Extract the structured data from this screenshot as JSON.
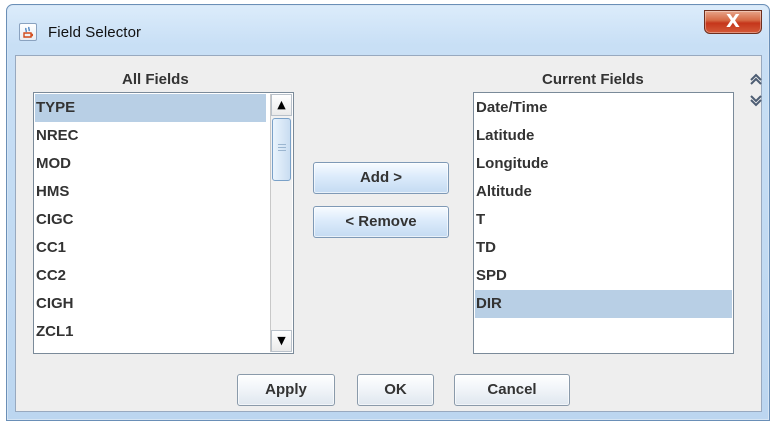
{
  "window": {
    "title": "Field Selector",
    "close_label": "X"
  },
  "all_fields": {
    "label": "All Fields",
    "items": [
      "TYPE",
      "NREC",
      "MOD",
      "HMS",
      "CIGC",
      "CC1",
      "CC2",
      "CIGH",
      "ZCL1"
    ],
    "selected": "TYPE"
  },
  "current_fields": {
    "label": "Current Fields",
    "items": [
      "Date/Time",
      "Latitude",
      "Longitude",
      "Altitude",
      "T",
      "TD",
      "SPD",
      "DIR"
    ],
    "selected": "DIR"
  },
  "buttons": {
    "add": "Add >",
    "remove": "< Remove",
    "apply": "Apply",
    "ok": "OK",
    "cancel": "Cancel"
  },
  "icons": {
    "window": "java-cup-icon",
    "close": "close-icon",
    "scroll_up": "up-arrow-icon",
    "scroll_down": "down-arrow-icon",
    "move_up": "move-up-icon",
    "move_down": "move-down-icon"
  },
  "colors": {
    "selected_row": "#b8cfe5",
    "close_button": "#c5361b",
    "window_frame": "#c8dff5"
  }
}
